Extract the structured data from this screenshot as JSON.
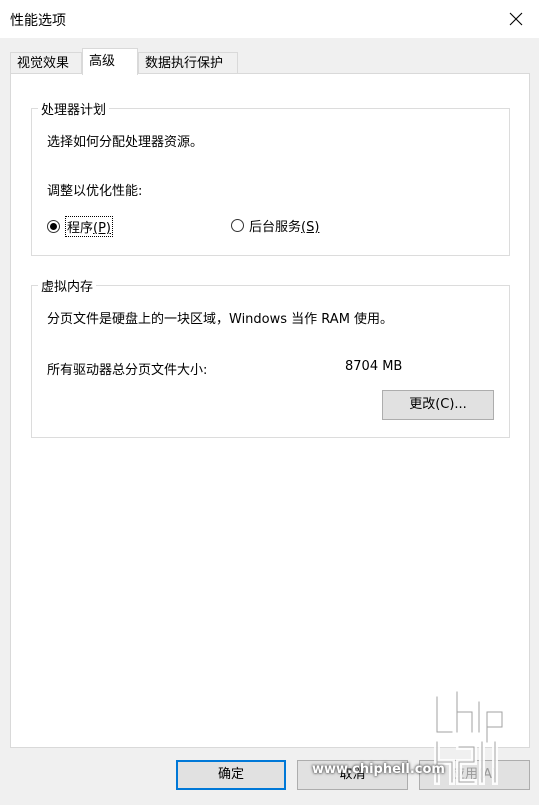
{
  "window": {
    "title": "性能选项",
    "close_icon": "close-icon"
  },
  "tabs": [
    {
      "label": "视觉效果",
      "active": false
    },
    {
      "label": "高级",
      "active": true
    },
    {
      "label": "数据执行保护",
      "active": false
    }
  ],
  "processor": {
    "legend": "处理器计划",
    "description": "选择如何分配处理器资源。",
    "adjust_label": "调整以优化性能:",
    "options": [
      {
        "label": "程序",
        "mnemonic": "(P)",
        "checked": true
      },
      {
        "label": "后台服务",
        "mnemonic": "(S)",
        "checked": false
      }
    ]
  },
  "virtual_memory": {
    "legend": "虚拟内存",
    "description": "分页文件是硬盘上的一块区域，Windows 当作 RAM 使用。",
    "total_label": "所有驱动器总分页文件大小:",
    "total_value": "8704 MB",
    "change_button": "更改(C)..."
  },
  "footer": {
    "ok": "确定",
    "cancel": "取消",
    "apply": "应用(A)"
  },
  "watermark": {
    "site": "www.chiphell.com"
  }
}
